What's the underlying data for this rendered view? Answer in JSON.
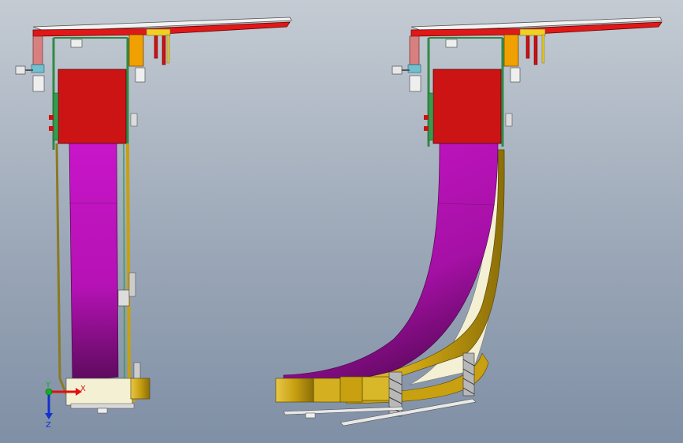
{
  "viewport": {
    "background_top": "#c4cbd3",
    "background_bottom": "#7f8fa5"
  },
  "model": {
    "views": [
      {
        "state": "retracted"
      },
      {
        "state": "extended"
      }
    ],
    "colors": {
      "motor_block": "#cc1414",
      "belt": "#b510b5",
      "gold_frame": "#c8a510",
      "green_frame": "#3a9a50",
      "red_rail": "#e01818",
      "orange_bracket": "#f0a000",
      "cream_panel": "#f4f0d4"
    }
  },
  "triad": {
    "x_label": "X",
    "y_label": "Y",
    "z_label": "Z",
    "x_color": "#e01010",
    "y_color": "#10b020",
    "z_color": "#1030d0"
  }
}
